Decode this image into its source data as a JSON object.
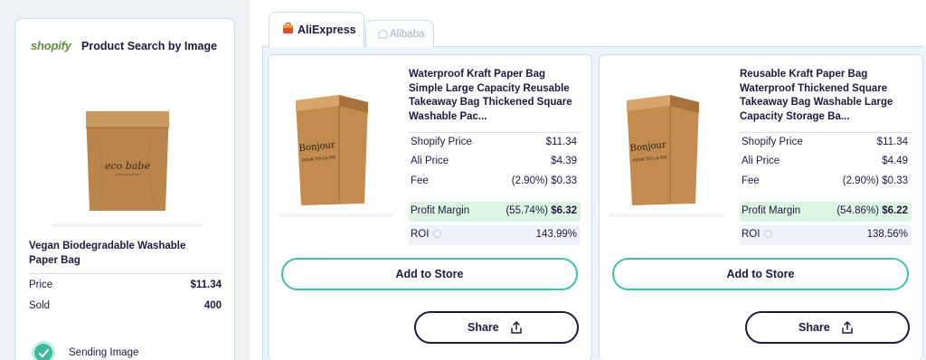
{
  "colors": {
    "accent_green": "#3fc1a5",
    "profit_bg": "#dcf5e3",
    "navy": "#1c1a3d",
    "shopify_green": "#5e8e3e",
    "panel_border": "#c7dbf2"
  },
  "left_panel": {
    "logo_text": "shopify",
    "title": "Product Search by Image",
    "product_name": "Vegan Biodegradable Washable Paper Bag",
    "bag_print": "eco babe",
    "rows": [
      {
        "label": "Price",
        "value": "$11.34"
      },
      {
        "label": "Sold",
        "value": "400"
      }
    ],
    "status": {
      "label": "Sending Image",
      "icon": "check-icon"
    }
  },
  "tabs": [
    {
      "label": "AliExpress",
      "icon": "aliexpress-icon",
      "active": true
    },
    {
      "label": "Alibaba",
      "icon": "alibaba-icon",
      "active": false
    }
  ],
  "cards": [
    {
      "title": "Waterproof Kraft Paper Bag Simple Large Capacity Reusable Takeaway Bag Thickened Square Washable Pac...",
      "bag_print": "Bonjour",
      "shopify_price_label": "Shopify Price",
      "shopify_price": "$11.34",
      "ali_price_label": "Ali Price",
      "ali_price": "$4.39",
      "fee_label": "Fee",
      "fee": "(2.90%) $0.33",
      "profit_label": "Profit Margin",
      "profit_pct": "(55.74%)",
      "profit_value": "$6.32",
      "roi_label": "ROI",
      "roi": "143.99%",
      "add_label": "Add to Store",
      "share_label": "Share"
    },
    {
      "title": "Reusable Kraft Paper Bag Waterproof Thickened Square Takeaway Bag Washable Large Capacity Storage Ba...",
      "bag_print": "Bonjour",
      "shopify_price_label": "Shopify Price",
      "shopify_price": "$11.34",
      "ali_price_label": "Ali Price",
      "ali_price": "$4.49",
      "fee_label": "Fee",
      "fee": "(2.90%) $0.33",
      "profit_label": "Profit Margin",
      "profit_pct": "(54.86%)",
      "profit_value": "$6.22",
      "roi_label": "ROI",
      "roi": "138.56%",
      "add_label": "Add to Store",
      "share_label": "Share"
    }
  ]
}
